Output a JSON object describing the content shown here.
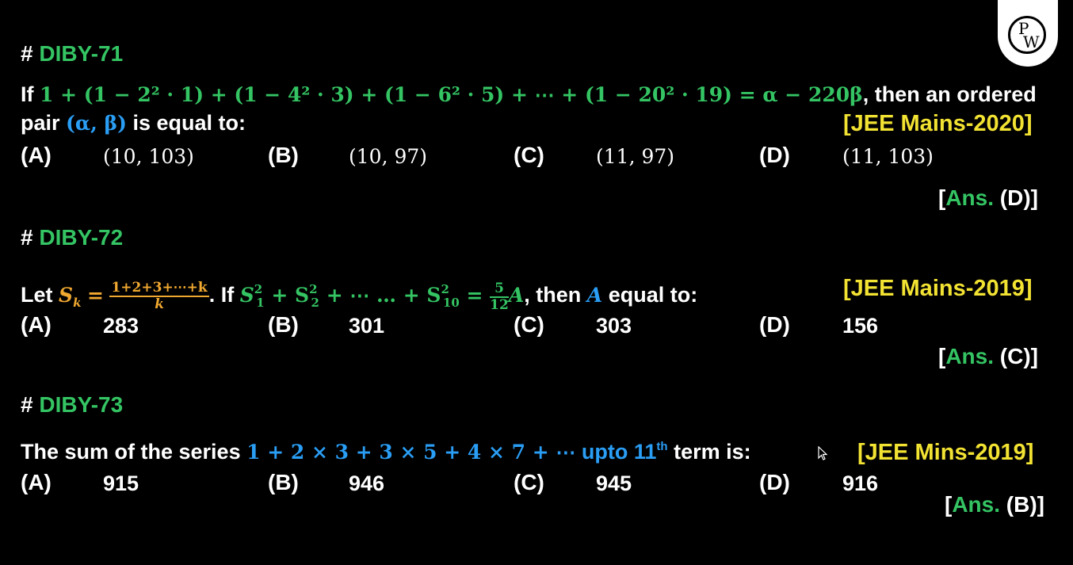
{
  "logo": {
    "top": "P",
    "bottom": "W"
  },
  "q71": {
    "hash": "#",
    "id": "DIBY-71",
    "if": "If",
    "expr": "1 + (1 − 2² · 1) + (1 − 4² · 3) + (1 − 6² · 5) + ⋯ + (1 − 20² · 19) = α − 220β",
    "rest1": ", then an ordered",
    "pair": "pair",
    "pair_math": "(α, β)",
    "rest2": "is equal to:",
    "exam": "[JEE Mains-2020]",
    "options": [
      {
        "label": "(A)",
        "value": "(10, 103)"
      },
      {
        "label": "(B)",
        "value": "(10, 97)"
      },
      {
        "label": "(C)",
        "value": "(11, 97)"
      },
      {
        "label": "(D)",
        "value": "(11, 103)"
      }
    ],
    "ans_open": "[",
    "ans_word": "Ans.",
    "ans_val": "(D)]"
  },
  "q72": {
    "hash": "#",
    "id": "DIBY-72",
    "let": "Let",
    "sk": "S",
    "sk_sub": "k",
    "eq": "=",
    "frac_num": "1+2+3+⋯+k",
    "frac_den": "k",
    "if": ". If",
    "sum": "S",
    "sum_expr_a": "+ S",
    "sum_expr_b": "+ ⋯ … + S",
    "eq2": "=",
    "frac2_num": "5",
    "frac2_den": "12",
    "A": "A",
    "then": ", then",
    "A2": "A",
    "equal_to": "equal to:",
    "exam": "[JEE Mains-2019]",
    "options": [
      {
        "label": "(A)",
        "value": "283"
      },
      {
        "label": "(B)",
        "value": "301"
      },
      {
        "label": "(C)",
        "value": "303"
      },
      {
        "label": "(D)",
        "value": "156"
      }
    ],
    "ans_open": "[",
    "ans_word": "Ans.",
    "ans_val": "(C)]"
  },
  "q73": {
    "hash": "#",
    "id": "DIBY-73",
    "lead": "The sum of the series",
    "expr": "1 + 2 × 3 + 3 × 5 + 4 × 7 + ⋯",
    "upto": "upto 11",
    "th": "th",
    "tail": "term is:",
    "exam": "[JEE Mins-2019]",
    "options": [
      {
        "label": "(A)",
        "value": "915"
      },
      {
        "label": "(B)",
        "value": "946"
      },
      {
        "label": "(C)",
        "value": "945"
      },
      {
        "label": "(D)",
        "value": "916"
      }
    ],
    "ans_open": "[",
    "ans_word": "Ans.",
    "ans_val": "(B)]"
  },
  "colors": {
    "background": "#000000",
    "green": "#34c463",
    "yellow": "#f2e232",
    "blue": "#2a9df4",
    "orange": "#f0a830"
  }
}
